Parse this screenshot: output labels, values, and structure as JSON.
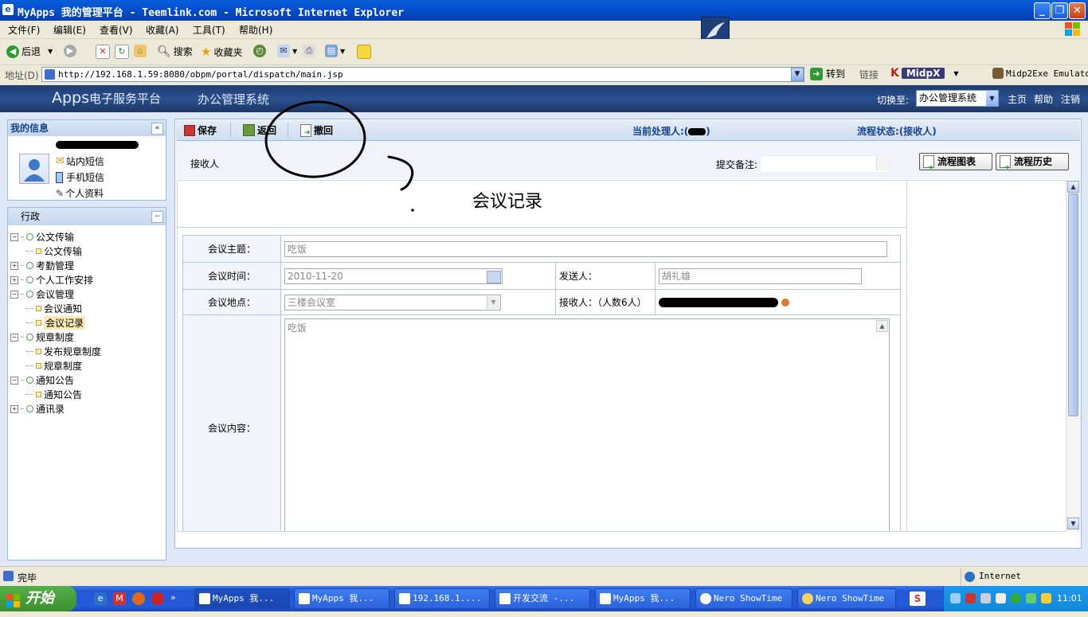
{
  "window": {
    "title": "MyApps 我的管理平台 - Teemlink.com - Microsoft Internet Explorer"
  },
  "menu": [
    "文件(F)",
    "编辑(E)",
    "查看(V)",
    "收藏(A)",
    "工具(T)",
    "帮助(H)"
  ],
  "toolbar": {
    "back": "后退",
    "search": "搜索",
    "favorites": "收藏夹"
  },
  "address": {
    "label": "地址(D)",
    "url": "http://192.168.1.59:8080/obpm/portal/dispatch/main.jsp",
    "go": "转到",
    "links": "链接",
    "midpx": "MidpX",
    "midp2exe": "Midp2Exe Emulato"
  },
  "app": {
    "brand_apps": "Apps",
    "brand_rest": "电子服务平台",
    "system_name": "办公管理系统",
    "switch_label": "切换至:",
    "switch_value": "办公管理系统",
    "nav_home": "主页",
    "nav_help": "帮助",
    "nav_logout": "注销"
  },
  "myinfo": {
    "title": "我的信息",
    "internal_msg": "站内短信",
    "mobile_msg": "手机短信",
    "profile": "个人资料"
  },
  "nav": {
    "title": "行政",
    "items": [
      {
        "label": "公文传输",
        "type": "folder",
        "expanded": true
      },
      {
        "label": "公文传输",
        "type": "leaf"
      },
      {
        "label": "考勤管理",
        "type": "folder",
        "expanded": false
      },
      {
        "label": "个人工作安排",
        "type": "folder",
        "expanded": false
      },
      {
        "label": "会议管理",
        "type": "folder",
        "expanded": true
      },
      {
        "label": "会议通知",
        "type": "leaf"
      },
      {
        "label": "会议记录",
        "type": "leaf",
        "selected": true
      },
      {
        "label": "规章制度",
        "type": "folder",
        "expanded": true
      },
      {
        "label": "发布规章制度",
        "type": "leaf"
      },
      {
        "label": "规章制度",
        "type": "leaf"
      },
      {
        "label": "通知公告",
        "type": "folder",
        "expanded": true
      },
      {
        "label": "通知公告",
        "type": "leaf"
      },
      {
        "label": "通讯录",
        "type": "folder",
        "expanded": false
      }
    ]
  },
  "doc_toolbar": {
    "save": "保存",
    "back": "返回",
    "withdraw": "撤回",
    "current_handler": "当前处理人:(",
    "current_handler_close": ")",
    "flow_status": "流程状态:(接收人)"
  },
  "doc_row2": {
    "receiver": "接收人",
    "remark_label": "提交备注:",
    "remark_value": "",
    "flow_chart": "流程图表",
    "flow_history": "流程历史"
  },
  "form": {
    "title": "会议记录",
    "topic_label": "会议主题：",
    "topic_value": "吃饭",
    "time_label": "会议时间：",
    "time_value": "2010-11-20",
    "sender_label": "发送人：",
    "sender_value": "胡礼雄",
    "place_label": "会议地点：",
    "place_value": "三楼会议室",
    "receiver_label": "接收人：（人数6人）",
    "content_label": "会议内容：",
    "content_value": "吃饭"
  },
  "status": {
    "done": "完毕",
    "zone": "Internet"
  },
  "taskbar": {
    "start": "开始",
    "tasks": [
      "MyApps 我...",
      "MyApps 我...",
      "192.168.1....",
      "开发交流 -...",
      "MyApps 我...",
      "Nero ShowTime",
      "Nero ShowTime"
    ],
    "clock": "11:01"
  },
  "colors": {
    "header_blue": "#2a5090",
    "panel_border": "#99bbe8",
    "title_blue": "#15428b"
  }
}
